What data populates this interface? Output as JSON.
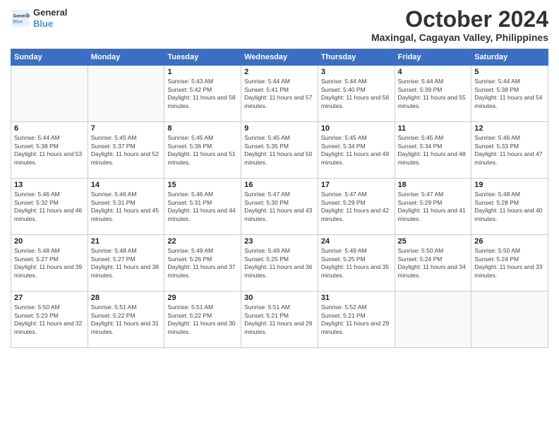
{
  "logo": {
    "line1": "General",
    "line2": "Blue"
  },
  "title": "October 2024",
  "location": "Maxingal, Cagayan Valley, Philippines",
  "days_of_week": [
    "Sunday",
    "Monday",
    "Tuesday",
    "Wednesday",
    "Thursday",
    "Friday",
    "Saturday"
  ],
  "weeks": [
    [
      {
        "day": "",
        "empty": true
      },
      {
        "day": "",
        "empty": true
      },
      {
        "day": "1",
        "sunrise": "5:43 AM",
        "sunset": "5:42 PM",
        "daylight": "11 hours and 58 minutes."
      },
      {
        "day": "2",
        "sunrise": "5:44 AM",
        "sunset": "5:41 PM",
        "daylight": "11 hours and 57 minutes."
      },
      {
        "day": "3",
        "sunrise": "5:44 AM",
        "sunset": "5:40 PM",
        "daylight": "11 hours and 56 minutes."
      },
      {
        "day": "4",
        "sunrise": "5:44 AM",
        "sunset": "5:39 PM",
        "daylight": "11 hours and 55 minutes."
      },
      {
        "day": "5",
        "sunrise": "5:44 AM",
        "sunset": "5:38 PM",
        "daylight": "11 hours and 54 minutes."
      }
    ],
    [
      {
        "day": "6",
        "sunrise": "5:44 AM",
        "sunset": "5:38 PM",
        "daylight": "11 hours and 53 minutes."
      },
      {
        "day": "7",
        "sunrise": "5:45 AM",
        "sunset": "5:37 PM",
        "daylight": "11 hours and 52 minutes."
      },
      {
        "day": "8",
        "sunrise": "5:45 AM",
        "sunset": "5:36 PM",
        "daylight": "11 hours and 51 minutes."
      },
      {
        "day": "9",
        "sunrise": "5:45 AM",
        "sunset": "5:35 PM",
        "daylight": "11 hours and 50 minutes."
      },
      {
        "day": "10",
        "sunrise": "5:45 AM",
        "sunset": "5:34 PM",
        "daylight": "11 hours and 49 minutes."
      },
      {
        "day": "11",
        "sunrise": "5:45 AM",
        "sunset": "5:34 PM",
        "daylight": "11 hours and 48 minutes."
      },
      {
        "day": "12",
        "sunrise": "5:46 AM",
        "sunset": "5:33 PM",
        "daylight": "11 hours and 47 minutes."
      }
    ],
    [
      {
        "day": "13",
        "sunrise": "5:46 AM",
        "sunset": "5:32 PM",
        "daylight": "11 hours and 46 minutes."
      },
      {
        "day": "14",
        "sunrise": "5:46 AM",
        "sunset": "5:31 PM",
        "daylight": "11 hours and 45 minutes."
      },
      {
        "day": "15",
        "sunrise": "5:46 AM",
        "sunset": "5:31 PM",
        "daylight": "11 hours and 44 minutes."
      },
      {
        "day": "16",
        "sunrise": "5:47 AM",
        "sunset": "5:30 PM",
        "daylight": "11 hours and 43 minutes."
      },
      {
        "day": "17",
        "sunrise": "5:47 AM",
        "sunset": "5:29 PM",
        "daylight": "11 hours and 42 minutes."
      },
      {
        "day": "18",
        "sunrise": "5:47 AM",
        "sunset": "5:29 PM",
        "daylight": "11 hours and 41 minutes."
      },
      {
        "day": "19",
        "sunrise": "5:48 AM",
        "sunset": "5:28 PM",
        "daylight": "11 hours and 40 minutes."
      }
    ],
    [
      {
        "day": "20",
        "sunrise": "5:48 AM",
        "sunset": "5:27 PM",
        "daylight": "11 hours and 39 minutes."
      },
      {
        "day": "21",
        "sunrise": "5:48 AM",
        "sunset": "5:27 PM",
        "daylight": "11 hours and 38 minutes."
      },
      {
        "day": "22",
        "sunrise": "5:49 AM",
        "sunset": "5:26 PM",
        "daylight": "11 hours and 37 minutes."
      },
      {
        "day": "23",
        "sunrise": "5:49 AM",
        "sunset": "5:25 PM",
        "daylight": "11 hours and 36 minutes."
      },
      {
        "day": "24",
        "sunrise": "5:49 AM",
        "sunset": "5:25 PM",
        "daylight": "11 hours and 35 minutes."
      },
      {
        "day": "25",
        "sunrise": "5:50 AM",
        "sunset": "5:24 PM",
        "daylight": "11 hours and 34 minutes."
      },
      {
        "day": "26",
        "sunrise": "5:50 AM",
        "sunset": "5:24 PM",
        "daylight": "11 hours and 33 minutes."
      }
    ],
    [
      {
        "day": "27",
        "sunrise": "5:50 AM",
        "sunset": "5:23 PM",
        "daylight": "11 hours and 32 minutes."
      },
      {
        "day": "28",
        "sunrise": "5:51 AM",
        "sunset": "5:22 PM",
        "daylight": "11 hours and 31 minutes."
      },
      {
        "day": "29",
        "sunrise": "5:51 AM",
        "sunset": "5:22 PM",
        "daylight": "11 hours and 30 minutes."
      },
      {
        "day": "30",
        "sunrise": "5:51 AM",
        "sunset": "5:21 PM",
        "daylight": "11 hours and 29 minutes."
      },
      {
        "day": "31",
        "sunrise": "5:52 AM",
        "sunset": "5:21 PM",
        "daylight": "11 hours and 29 minutes."
      },
      {
        "day": "",
        "empty": true
      },
      {
        "day": "",
        "empty": true
      }
    ]
  ]
}
